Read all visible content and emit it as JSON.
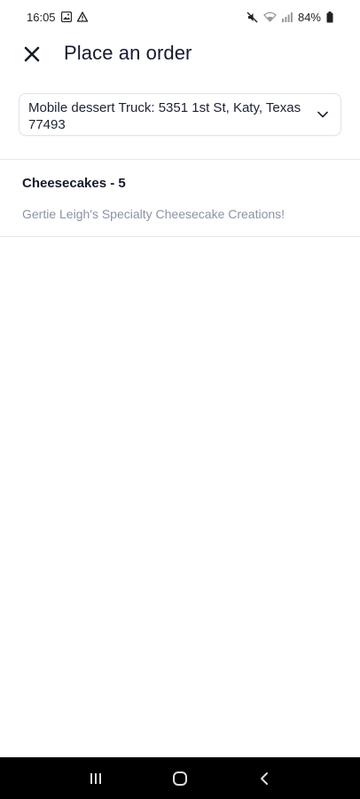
{
  "status_bar": {
    "time": "16:05",
    "battery": "84%"
  },
  "header": {
    "title": "Place an order",
    "close_icon": "close-icon"
  },
  "location": {
    "selected": "Mobile dessert Truck: 5351 1st St, Katy, Texas 77493"
  },
  "categories": [
    {
      "title": "Cheesecakes - 5",
      "description": "Gertie Leigh's Specialty Cheesecake Creations!"
    }
  ],
  "nav": {
    "recents_icon": "recents-icon",
    "home_icon": "home-icon",
    "back_icon": "back-icon"
  },
  "colors": {
    "title_text": "#161a2e",
    "description_text": "#8a92a6",
    "border": "#e0e3e8",
    "nav_bar": "#000000"
  }
}
